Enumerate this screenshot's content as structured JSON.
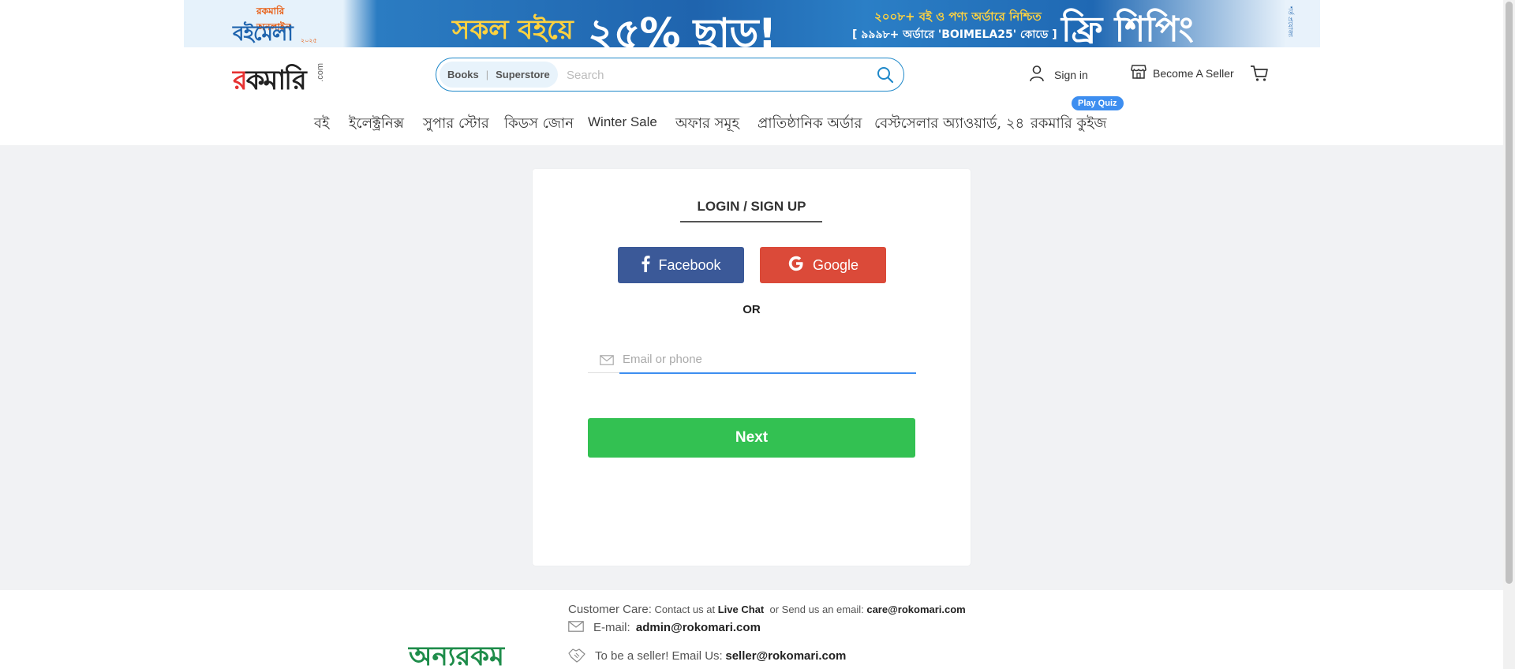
{
  "banner": {
    "logo_top": "রকমারি অনলাইন",
    "logo_main": "বইমেলা",
    "logo_year": "২০২৫",
    "headline": "সকল বইয়ে",
    "discount": "২৫% ছাড়!",
    "line1": "২০০৮+ বই ও পণ্য অর্ডারে নিশ্চিত",
    "line2": "[ ৯৯৯৮+ অর্ডারে 'BOIMELA25' কোডে ]",
    "shipping": "ফ্রি শিপিং",
    "note": "শর্ত প্রযোজ্য"
  },
  "header": {
    "logo_text_red": "র",
    "logo_text": "কমারি",
    "logo_com": ".com",
    "search": {
      "tab_books": "Books",
      "tab_superstore": "Superstore",
      "placeholder": "Search",
      "value": ""
    },
    "signin_label": "Sign in",
    "seller_label": "Become A Seller"
  },
  "nav": {
    "items": [
      "বই",
      "ইলেক্ট্রনিক্স",
      "সুপার স্টোর",
      "কিডস জোন",
      "Winter Sale",
      "অফার সমূহ",
      "প্রাতিষ্ঠানিক অর্ডার",
      "বেস্টসেলার অ্যাওয়ার্ড, ২৪",
      "রকমারি কুইজ"
    ],
    "quiz_badge": "Play Quiz"
  },
  "login": {
    "title": "LOGIN / SIGN UP",
    "facebook_label": "Facebook",
    "google_label": "Google",
    "or_label": "OR",
    "email_placeholder": "Email or phone",
    "email_value": "",
    "next_label": "Next"
  },
  "footer": {
    "logo": "অন্যরকম",
    "care_label": "Customer  Care:",
    "care_contact": "Contact us at",
    "live_chat": "Live Chat",
    "care_email_text": "or Send us an email:",
    "care_email": "care@rokomari.com",
    "email_label": "E-mail:",
    "admin_email": "admin@rokomari.com",
    "seller_text": "To be a seller!  Email Us:",
    "seller_email": "seller@rokomari.com"
  },
  "colors": {
    "brand_blue": "#1e88c9",
    "facebook": "#3b5998",
    "google": "#db4a39",
    "next_green": "#33c152",
    "quiz_badge": "#3d8ef0",
    "page_bg": "#f1f2f4"
  },
  "icons": [
    "search-icon",
    "user-icon",
    "store-icon",
    "cart-icon",
    "facebook-icon",
    "google-icon",
    "envelope-icon",
    "handshake-icon"
  ]
}
